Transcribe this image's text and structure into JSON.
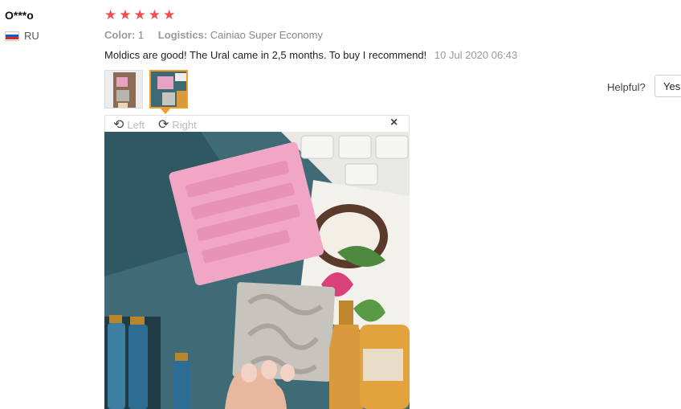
{
  "reviewer": {
    "name": "O***o",
    "country_code": "RU"
  },
  "rating": {
    "stars": 5,
    "max": 5
  },
  "details": {
    "color_label": "Color:",
    "color_value": "1",
    "logistics_label": "Logistics:",
    "logistics_value": "Cainiao Super Economy"
  },
  "review": {
    "text": "Moldics are good! The Ural came in 2,5 months. To buy I recommend!",
    "date": "10 Jul 2020 06:43"
  },
  "helpful": {
    "label": "Helpful?",
    "yes_label": "Yes"
  },
  "viewer": {
    "left_label": "Left",
    "right_label": "Right",
    "close_symbol": "×"
  },
  "colors": {
    "star": "#f04f4f",
    "thumb_active_border": "#f59a23"
  },
  "icons": [
    "flag-ru-icon",
    "star-icon",
    "rotate-left-icon",
    "rotate-right-icon",
    "close-icon"
  ]
}
